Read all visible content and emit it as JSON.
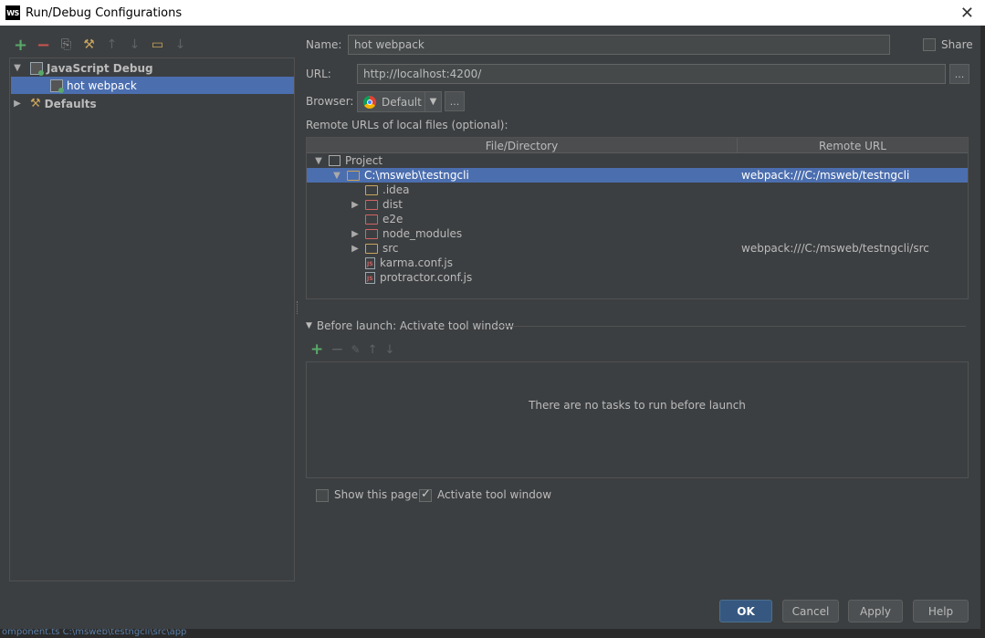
{
  "window": {
    "logo_text": "WS",
    "title": "Run/Debug Configurations",
    "close_glyph": "✕"
  },
  "toolbar": {
    "add_glyph": "+",
    "remove_glyph": "−",
    "copy_glyph": "⎘",
    "edit_defaults_glyph": "⚒",
    "move_up_glyph": "↑",
    "move_down_glyph": "↓",
    "folder_glyph": "▭",
    "sort_glyph": "↓"
  },
  "tree": {
    "group_label": "JavaScript Debug",
    "selected_item": "hot webpack",
    "defaults_label": "Defaults"
  },
  "form": {
    "name_label": "Name:",
    "name_value": "hot webpack",
    "share_label": "Share",
    "url_label": "URL:",
    "url_value": "http://localhost:4200/",
    "browse_glyph": "...",
    "browser_label": "Browser:",
    "browser_value": "Default",
    "browser_more_glyph": "...",
    "remote_urls_label": "Remote URLs of local files (optional):"
  },
  "url_table": {
    "columns": [
      "File/Directory",
      "Remote URL"
    ],
    "rows": [
      {
        "name": "Project",
        "remote": "",
        "kind": "project",
        "expander": "▼"
      },
      {
        "name": "C:\\msweb\\testngcli",
        "remote": "webpack:///C:/msweb/testngcli",
        "kind": "folder",
        "expander": "▼"
      },
      {
        "name": ".idea",
        "remote": "",
        "kind": "folder",
        "expander": ""
      },
      {
        "name": "dist",
        "remote": "",
        "kind": "folder-red",
        "expander": "▶"
      },
      {
        "name": "e2e",
        "remote": "",
        "kind": "folder-red",
        "expander": ""
      },
      {
        "name": "node_modules",
        "remote": "",
        "kind": "folder-red",
        "expander": "▶"
      },
      {
        "name": "src",
        "remote": "webpack:///C:/msweb/testngcli/src",
        "kind": "folder",
        "expander": "▶"
      },
      {
        "name": "karma.conf.js",
        "remote": "",
        "kind": "js",
        "expander": ""
      },
      {
        "name": "protractor.conf.js",
        "remote": "",
        "kind": "js",
        "expander": ""
      }
    ]
  },
  "before_launch": {
    "title": "Before launch: Activate tool window",
    "empty_text": "There are no tasks to run before launch"
  },
  "options": {
    "show_page_label": "Show this page",
    "show_page_checked": false,
    "activate_label": "Activate tool window",
    "activate_checked": true
  },
  "buttons": {
    "ok": "OK",
    "cancel": "Cancel",
    "apply": "Apply",
    "help": "Help"
  },
  "statusbar": {
    "text": "omponent.ts   C:\\msweb\\testngcli\\src\\app"
  }
}
